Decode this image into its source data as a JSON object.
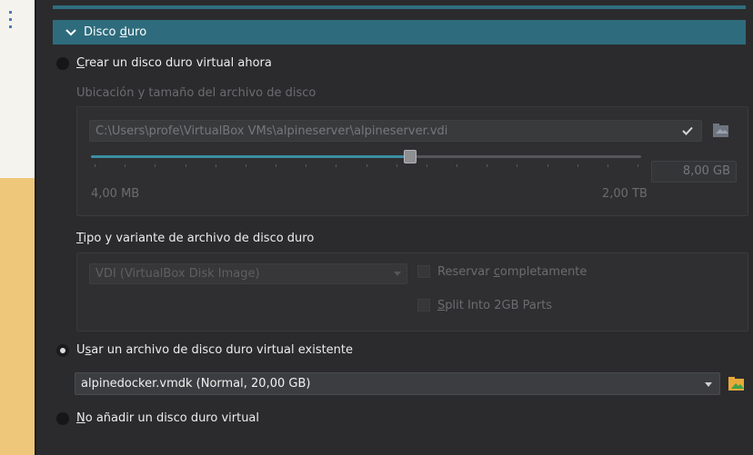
{
  "section": {
    "title_before": "Disco ",
    "title_mnemonic": "d",
    "title_after": "uro"
  },
  "option_create": {
    "mnemonic": "C",
    "rest": "rear un disco duro virtual ahora",
    "checked": false
  },
  "location": {
    "label": "Ubicación y tamaño del archivo de disco",
    "path": "C:\\Users\\profe\\VirtualBox VMs\\alpineserver\\alpineserver.vdi",
    "size_value": "8,00 GB",
    "slider_min": "4,00 MB",
    "slider_max": "2,00 TB",
    "slider_fraction": 0.58
  },
  "type": {
    "label_mnemonic": "T",
    "label_rest": "ipo y variante de archivo de disco duro",
    "format_selected": "VDI (VirtualBox Disk Image)",
    "reserve_before": "Reservar ",
    "reserve_mnemonic": "c",
    "reserve_after": "ompletamente",
    "split_mnemonic": "S",
    "split_rest": "plit Into 2GB Parts"
  },
  "option_existing": {
    "before": "U",
    "mnemonic": "s",
    "rest": "ar un archivo de disco duro virtual existente",
    "checked": true,
    "selected_file": "alpinedocker.vmdk (Normal, 20,00 GB)"
  },
  "option_none": {
    "mnemonic": "N",
    "rest": "o añadir un disco duro virtual",
    "checked": false
  },
  "icons": {
    "section_toggle": "chevron-down-icon",
    "path_confirm": "checkmark-icon",
    "path_folder": "folder-picker-icon",
    "existing_folder": "folder-picker-icon"
  },
  "colors": {
    "accent": "#2e6c7d",
    "slider_fill": "#3a8ea3",
    "background": "#2b2b2d"
  }
}
